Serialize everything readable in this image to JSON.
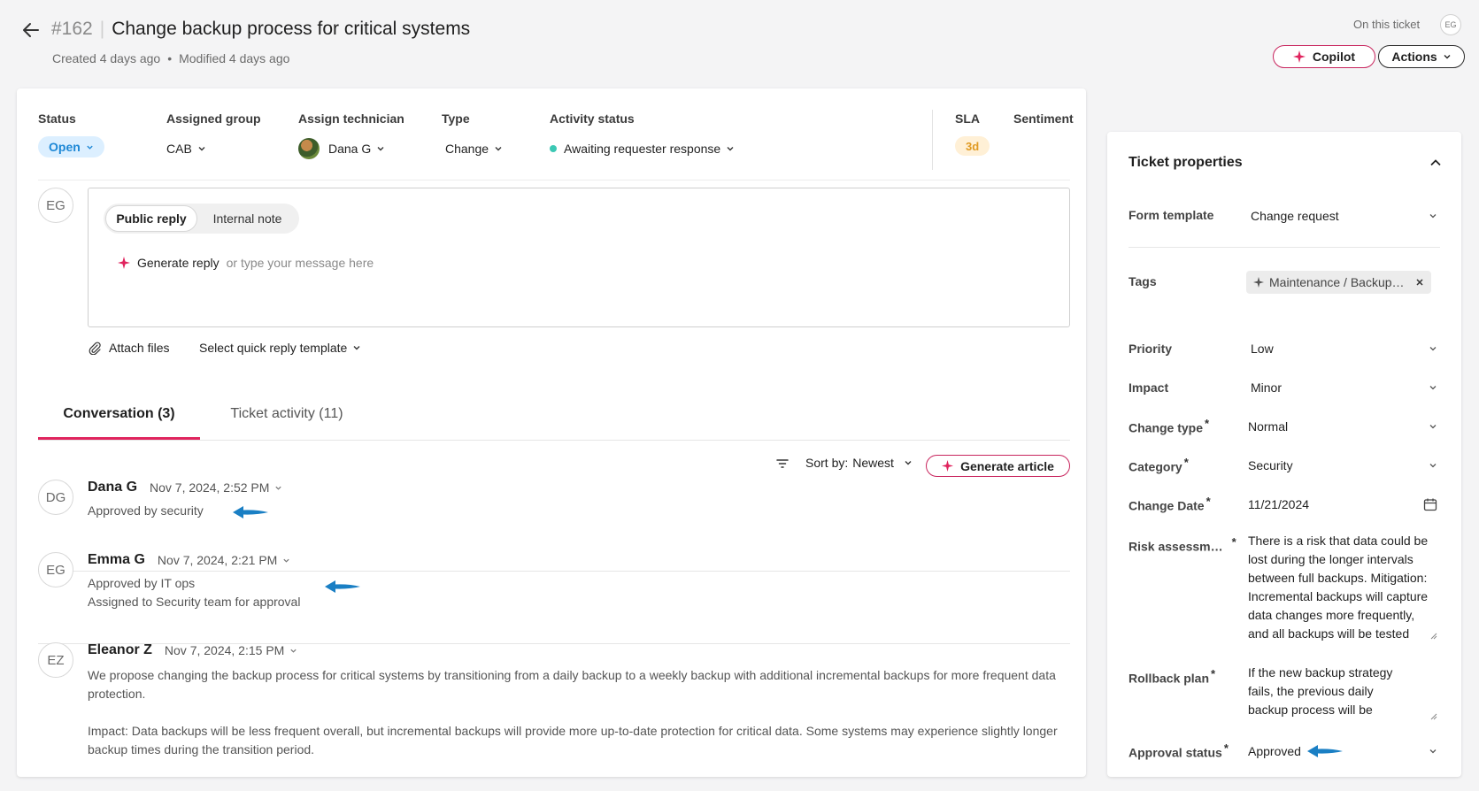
{
  "header": {
    "ticket_number": "#162",
    "title": "Change backup process for critical systems",
    "created": "Created 4 days ago",
    "separator": "•",
    "modified": "Modified 4 days ago",
    "on_this_ticket": "On this ticket",
    "viewer_initials": "EG",
    "copilot_label": "Copilot",
    "actions_label": "Actions"
  },
  "summary": {
    "status": {
      "label": "Status",
      "value": "Open"
    },
    "group": {
      "label": "Assigned group",
      "value": "CAB"
    },
    "technician": {
      "label": "Assign technician",
      "value": "Dana G"
    },
    "type": {
      "label": "Type",
      "value": "Change"
    },
    "activity": {
      "label": "Activity status",
      "value": "Awaiting requester response",
      "dot_color": "#3cc8b4"
    },
    "sla": {
      "label": "SLA",
      "value": "3d"
    },
    "sentiment": {
      "label": "Sentiment"
    }
  },
  "composer": {
    "avatar": "EG",
    "public_reply": "Public reply",
    "internal_note": "Internal note",
    "generate_reply": "Generate reply",
    "placeholder": "or type your message here",
    "attach_files": "Attach files",
    "quick_reply": "Select quick reply template"
  },
  "tabs": {
    "conversation": "Conversation (3)",
    "activity": "Ticket activity (11)"
  },
  "toolbar": {
    "sort_label": "Sort by:",
    "sort_value": "Newest",
    "generate_article": "Generate article"
  },
  "messages": [
    {
      "initials": "DG",
      "author": "Dana G",
      "time": "Nov 7, 2024, 2:52 PM",
      "lines": [
        "Approved by security"
      ]
    },
    {
      "initials": "EG",
      "author": "Emma G",
      "time": "Nov 7, 2024, 2:21 PM",
      "lines": [
        "Approved by IT ops",
        "Assigned to Security team for approval"
      ]
    },
    {
      "initials": "EZ",
      "author": "Eleanor Z",
      "time": "Nov 7, 2024, 2:15 PM",
      "lines": [
        "We propose changing the backup process for critical systems by transitioning from a daily backup to a weekly backup with additional incremental backups for more frequent data protection.",
        "Impact: Data backups will be less frequent overall, but incremental backups will provide more up-to-date protection for critical data. Some systems may experience slightly longer backup times during the transition period."
      ]
    }
  ],
  "properties": {
    "title": "Ticket properties",
    "form_template": {
      "label": "Form template",
      "value": "Change request"
    },
    "tags": {
      "label": "Tags",
      "value": "Maintenance / Backup…"
    },
    "priority": {
      "label": "Priority",
      "value": "Low"
    },
    "impact": {
      "label": "Impact",
      "value": "Minor"
    },
    "change_type": {
      "label": "Change type",
      "value": "Normal"
    },
    "category": {
      "label": "Category",
      "value": "Security"
    },
    "change_date": {
      "label": "Change Date",
      "value": "11/21/2024"
    },
    "risk": {
      "label": "Risk assessm…",
      "value": "There is a risk that data could be lost during the longer intervals between full backups. Mitigation: Incremental backups will capture data changes more frequently, and all backups will be tested"
    },
    "rollback": {
      "label": "Rollback plan",
      "value": "If the new backup strategy fails, the previous daily backup process will be reinstated."
    },
    "approval": {
      "label": "Approval status",
      "value": "Approved"
    }
  },
  "colors": {
    "accent": "#e0245e",
    "annotation_arrow": "#1a7fc4",
    "open_badge_bg": "#dcefff",
    "sla_badge_bg": "#fff0d6"
  }
}
